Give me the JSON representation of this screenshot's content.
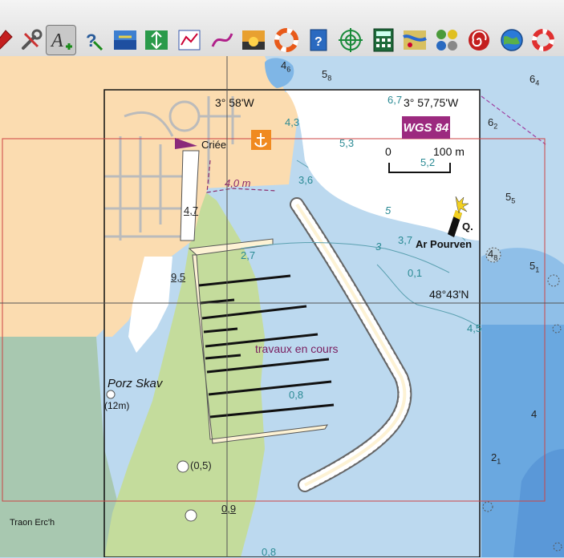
{
  "toolbar": {
    "buttons": [
      {
        "name": "tool-red-button",
        "icon": "red-marker-icon"
      },
      {
        "name": "tools-button",
        "icon": "wrench-screwdriver-icon"
      },
      {
        "name": "add-text-button",
        "icon": "text-add-icon",
        "active": true
      },
      {
        "name": "help-query-button",
        "icon": "question-cursor-icon"
      },
      {
        "name": "tide-height-button",
        "icon": "tide-arrows-icon"
      },
      {
        "name": "tide-curve-button",
        "icon": "tide-wave-icon"
      },
      {
        "name": "chart-graph-button",
        "icon": "graph-icon"
      },
      {
        "name": "route-button",
        "icon": "route-line-icon"
      },
      {
        "name": "sunset-button",
        "icon": "sunset-icon"
      },
      {
        "name": "lifebuoy-button",
        "icon": "lifebuoy-icon"
      },
      {
        "name": "help-book-button",
        "icon": "help-book-icon"
      },
      {
        "name": "target-button",
        "icon": "crosshair-target-icon"
      },
      {
        "name": "calculator-button",
        "icon": "calculator-icon"
      },
      {
        "name": "weather-map-button",
        "icon": "weather-map-icon"
      },
      {
        "name": "gps-settings-button",
        "icon": "gps-settings-icon"
      },
      {
        "name": "spiral-button",
        "icon": "spiral-icon"
      },
      {
        "name": "globe-button",
        "icon": "globe-icon"
      },
      {
        "name": "rescue-button",
        "icon": "rescue-buoy-icon"
      }
    ]
  },
  "map": {
    "coords": {
      "lon_1": "3° 58'W",
      "lon_2": "3° 57,75'W",
      "lat_1": "48°43'N"
    },
    "datum_badge": "WGS 84",
    "scale": {
      "zero": "0",
      "end": "100 m"
    },
    "place_labels": {
      "criee": "Criée",
      "porz_skav": "Porz Skav",
      "porz_skav_height": "(12m)",
      "traon_erch": "Traon Erc'h",
      "light_char": "Q.",
      "ar_pourven": "Ar Pourven",
      "works": "travaux en cours",
      "depth_limit": "4,0 m"
    },
    "soundings": [
      {
        "text": "4",
        "sub": "6"
      },
      {
        "text": "5",
        "sub": "8"
      },
      {
        "text": "6",
        "sub": "4"
      },
      {
        "text": "6,7"
      },
      {
        "text": "4,3"
      },
      {
        "text": "6",
        "sub": "2"
      },
      {
        "text": "5,3"
      },
      {
        "text": "5,2"
      },
      {
        "text": "3,6"
      },
      {
        "text": "5",
        "sub": "5"
      },
      {
        "text": "5"
      },
      {
        "text": "4,7"
      },
      {
        "text": "2,7"
      },
      {
        "text": "3"
      },
      {
        "text": "3,7"
      },
      {
        "text": "4",
        "sub": "8"
      },
      {
        "text": "5",
        "sub": "1"
      },
      {
        "text": "0,1"
      },
      {
        "text": "9,5"
      },
      {
        "text": "4,5"
      },
      {
        "text": "0,8"
      },
      {
        "text": "4"
      },
      {
        "text": "2",
        "sub": "1"
      },
      {
        "text": "(0,5)"
      },
      {
        "text": "0,9"
      },
      {
        "text": "0,8"
      }
    ]
  },
  "colors": {
    "land": "#fbdcb0",
    "drying": "#c4dc9c",
    "shallow": "#dbeef8",
    "mid": "#bcd9ef",
    "deep": "#7fb6e6",
    "deeper": "#5ea0de",
    "accent": "#9c2a7f"
  }
}
